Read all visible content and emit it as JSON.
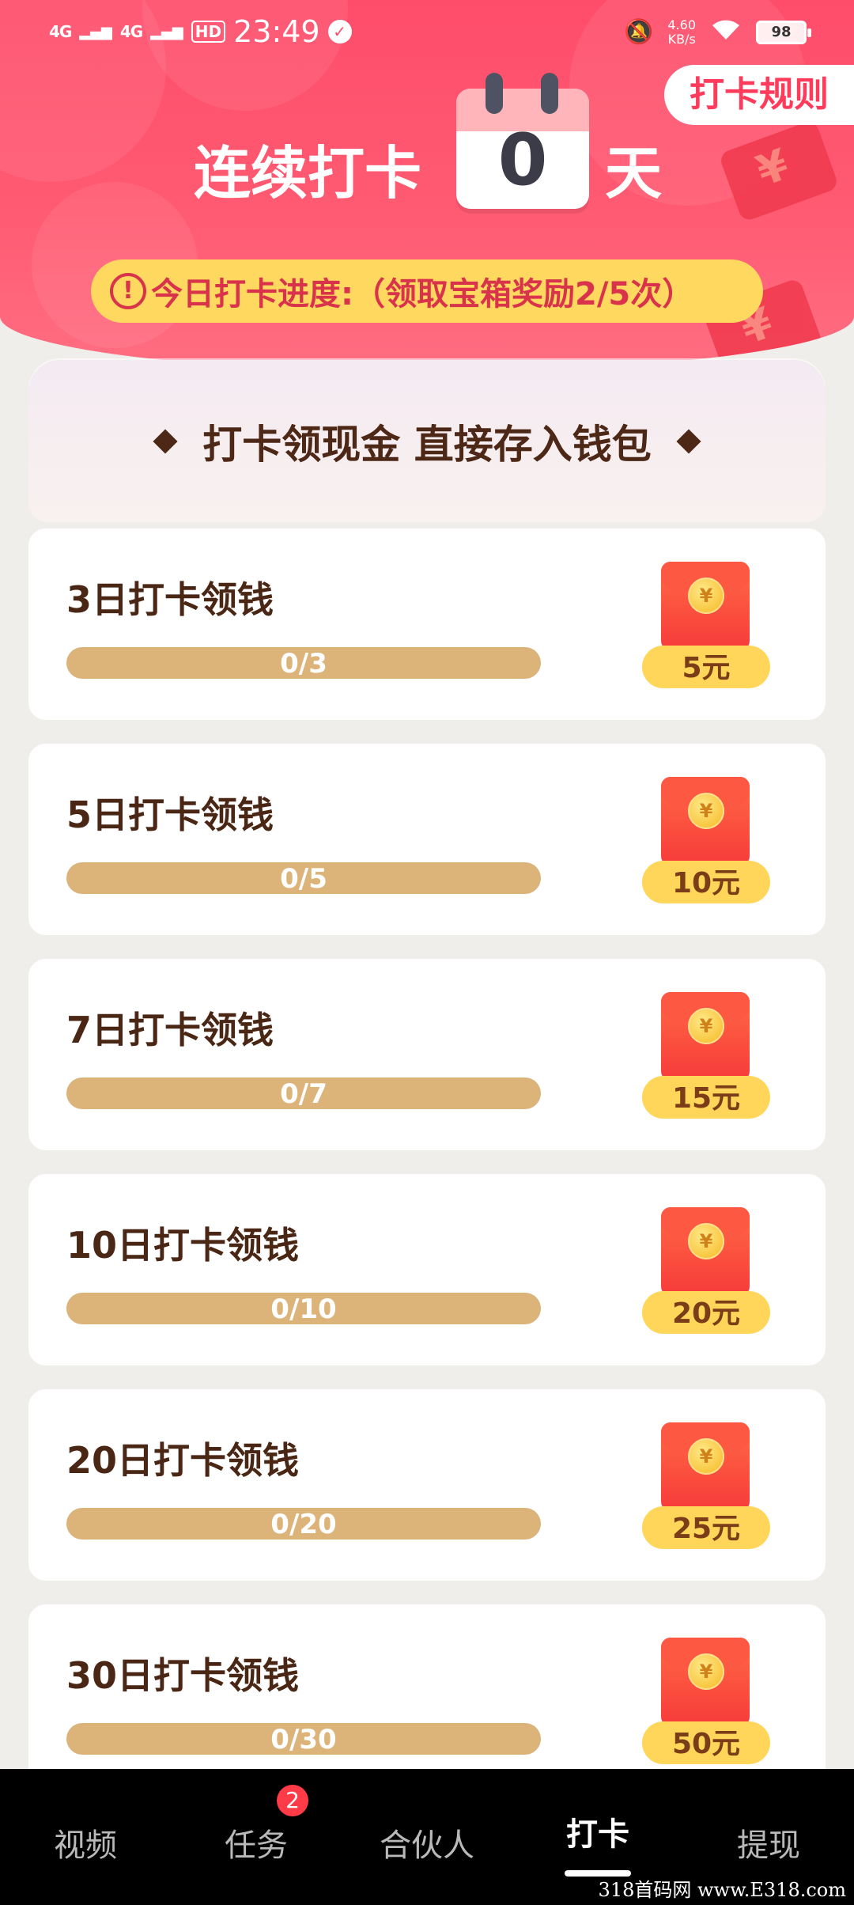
{
  "status_bar": {
    "signal1": "4G",
    "signal2": "4G",
    "hd": "HD",
    "time": "23:49",
    "net_speed_value": "4.60",
    "net_speed_unit": "KB/s",
    "battery": "98"
  },
  "header": {
    "rules_label": "打卡规则",
    "streak_label": "连续打卡",
    "streak_days": "0",
    "streak_unit": "天",
    "progress_text": "今日打卡进度:（领取宝箱奖励2/5次）"
  },
  "banner": {
    "text": "打卡领现金 直接存入钱包"
  },
  "rewards": [
    {
      "title": "3日打卡领钱",
      "progress_text": "0/3",
      "current": 0,
      "target": 3,
      "amount": "5元"
    },
    {
      "title": "5日打卡领钱",
      "progress_text": "0/5",
      "current": 0,
      "target": 5,
      "amount": "10元"
    },
    {
      "title": "7日打卡领钱",
      "progress_text": "0/7",
      "current": 0,
      "target": 7,
      "amount": "15元"
    },
    {
      "title": "10日打卡领钱",
      "progress_text": "0/10",
      "current": 0,
      "target": 10,
      "amount": "20元"
    },
    {
      "title": "20日打卡领钱",
      "progress_text": "0/20",
      "current": 0,
      "target": 20,
      "amount": "25元"
    },
    {
      "title": "30日打卡领钱",
      "progress_text": "0/30",
      "current": 0,
      "target": 30,
      "amount": "50元"
    }
  ],
  "coin_symbol": "¥",
  "nav": {
    "items": [
      {
        "label": "视频"
      },
      {
        "label": "任务",
        "badge": "2"
      },
      {
        "label": "合伙人"
      },
      {
        "label": "打卡",
        "active": true
      },
      {
        "label": "提现"
      }
    ]
  },
  "watermark": "318首码网 www.E318.com",
  "colors": {
    "header_red": "#fe4d6b",
    "pill_yellow": "#ffd860",
    "bar_tan": "#dcb47a",
    "text_brown": "#4a2614"
  }
}
